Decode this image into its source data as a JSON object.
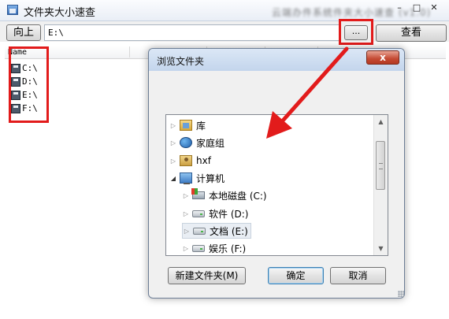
{
  "window": {
    "title": "文件夹大小速查",
    "blurred_title": "云端办件系统件夹大小速查 (v1.0)",
    "controls": {
      "minimize": "–",
      "maximize": "□",
      "close": "✕"
    }
  },
  "toolbar": {
    "up_label": "向上",
    "path_value": "E:\\",
    "browse_label": "...",
    "view_label": "查看"
  },
  "list": {
    "column_name": "Name",
    "drives": [
      "C:\\",
      "D:\\",
      "E:\\",
      "F:\\"
    ]
  },
  "dialog": {
    "title": "浏览文件夹",
    "close_label": "x",
    "tree": [
      {
        "label": "库",
        "icon": "library-icon"
      },
      {
        "label": "家庭组",
        "icon": "homegroup-icon"
      },
      {
        "label": "hxf",
        "icon": "user-folder-icon"
      },
      {
        "label": "计算机",
        "icon": "computer-icon"
      },
      {
        "label": "本地磁盘 (C:)",
        "icon": "system-drive-icon"
      },
      {
        "label": "软件 (D:)",
        "icon": "drive-icon"
      },
      {
        "label": "文档 (E:)",
        "icon": "drive-icon",
        "selected": true
      },
      {
        "label": "娱乐 (F:)",
        "icon": "drive-icon"
      }
    ],
    "buttons": {
      "new_folder": "新建文件夹(M)",
      "ok": "确定",
      "cancel": "取消"
    }
  },
  "colors": {
    "highlight": "#e21b1b",
    "accent_button": "#3c7fb1"
  }
}
